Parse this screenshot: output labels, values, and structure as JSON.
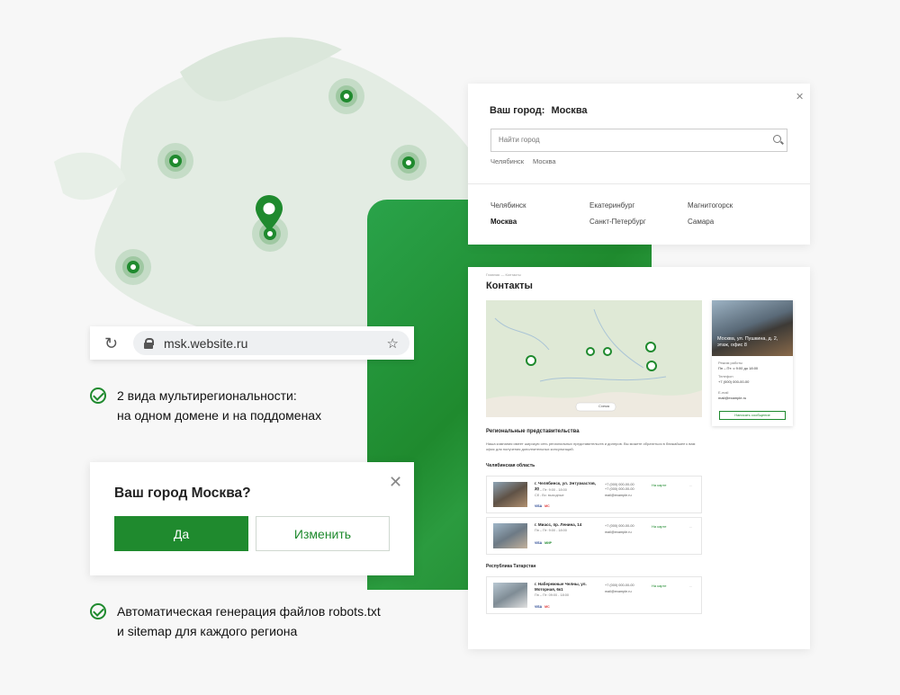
{
  "browser": {
    "url": "msk.website.ru"
  },
  "features": [
    {
      "line1": "2 вида мультирегиональности:",
      "line2": "на одном домене и на поддоменах"
    },
    {
      "line1": "Автоматическая генерация файлов robots.txt",
      "line2": "и sitemap для каждого региона"
    }
  ],
  "confirm_dialog": {
    "question": "Ваш город Москва?",
    "yes_label": "Да",
    "change_label": "Изменить",
    "close_glyph": "✕"
  },
  "city_panel": {
    "title_prefix": "Ваш город:",
    "title_city": "Москва",
    "search_placeholder": "Найти город",
    "recent": [
      "Челябинск",
      "Москва"
    ],
    "cities": [
      "Челябинск",
      "Екатеринбург",
      "Магнитогорск",
      "Москва",
      "Санкт-Петербург",
      "Самара"
    ],
    "close_glyph": "✕"
  },
  "contacts": {
    "breadcrumb": "Главная — Контакты",
    "title": "Контакты",
    "office_caption": "Москва, ул. Пушкина, д. 2, этаж, офис 8",
    "office_hours_label": "Режим работы",
    "office_hours": "Пн – Пт: с 9:00 до 18:00",
    "office_phone_label": "Телефон",
    "office_phone": "+7 (000) 000-00-00",
    "office_email_label": "E-mail",
    "office_email": "mail@example.ru",
    "office_button": "Написать сообщение",
    "section_title": "Региональные представительства",
    "section_text": "Наша компания имеет широкую сеть региональных представительств и дилеров. Вы можете обратиться в ближайшее к вам офис для получения дополнительных консультаций.",
    "region1": "Челябинская область",
    "region2": "Республика Татарстан",
    "offices": [
      {
        "address": "г. Челябинск, ул. Энтузиастов, 30",
        "hours": "Пн – Пт: 9:00 - 18:00",
        "extra": "Сб - Вс: выходные",
        "phone1": "+7 (000) 000-00-00",
        "phone2": "+7 (000) 000-00-00",
        "email": "mail@example.ru",
        "route": "На карте",
        "more": "..."
      },
      {
        "address": "г. Миасс, пр. Ленина, 14",
        "hours": "Пн – Пт: 9:00 - 18:00",
        "extra": "",
        "phone1": "+7 (000) 000-00-00",
        "phone2": "",
        "email": "mail@example.ru",
        "route": "На карте",
        "more": "..."
      },
      {
        "address": "г. Набережные Челны, ул. Моторная, 6к1",
        "hours": "Пн – Пт: 09:00 - 18:00",
        "extra": "",
        "phone1": "+7 (000) 000-00-00",
        "phone2": "",
        "email": "mail@example.ru",
        "route": "На карте",
        "more": "..."
      }
    ],
    "pay_labels": [
      "VISA",
      "MC",
      "МИР"
    ],
    "map_controls": "Схема"
  },
  "colors": {
    "brand": "#1f8a2e"
  }
}
